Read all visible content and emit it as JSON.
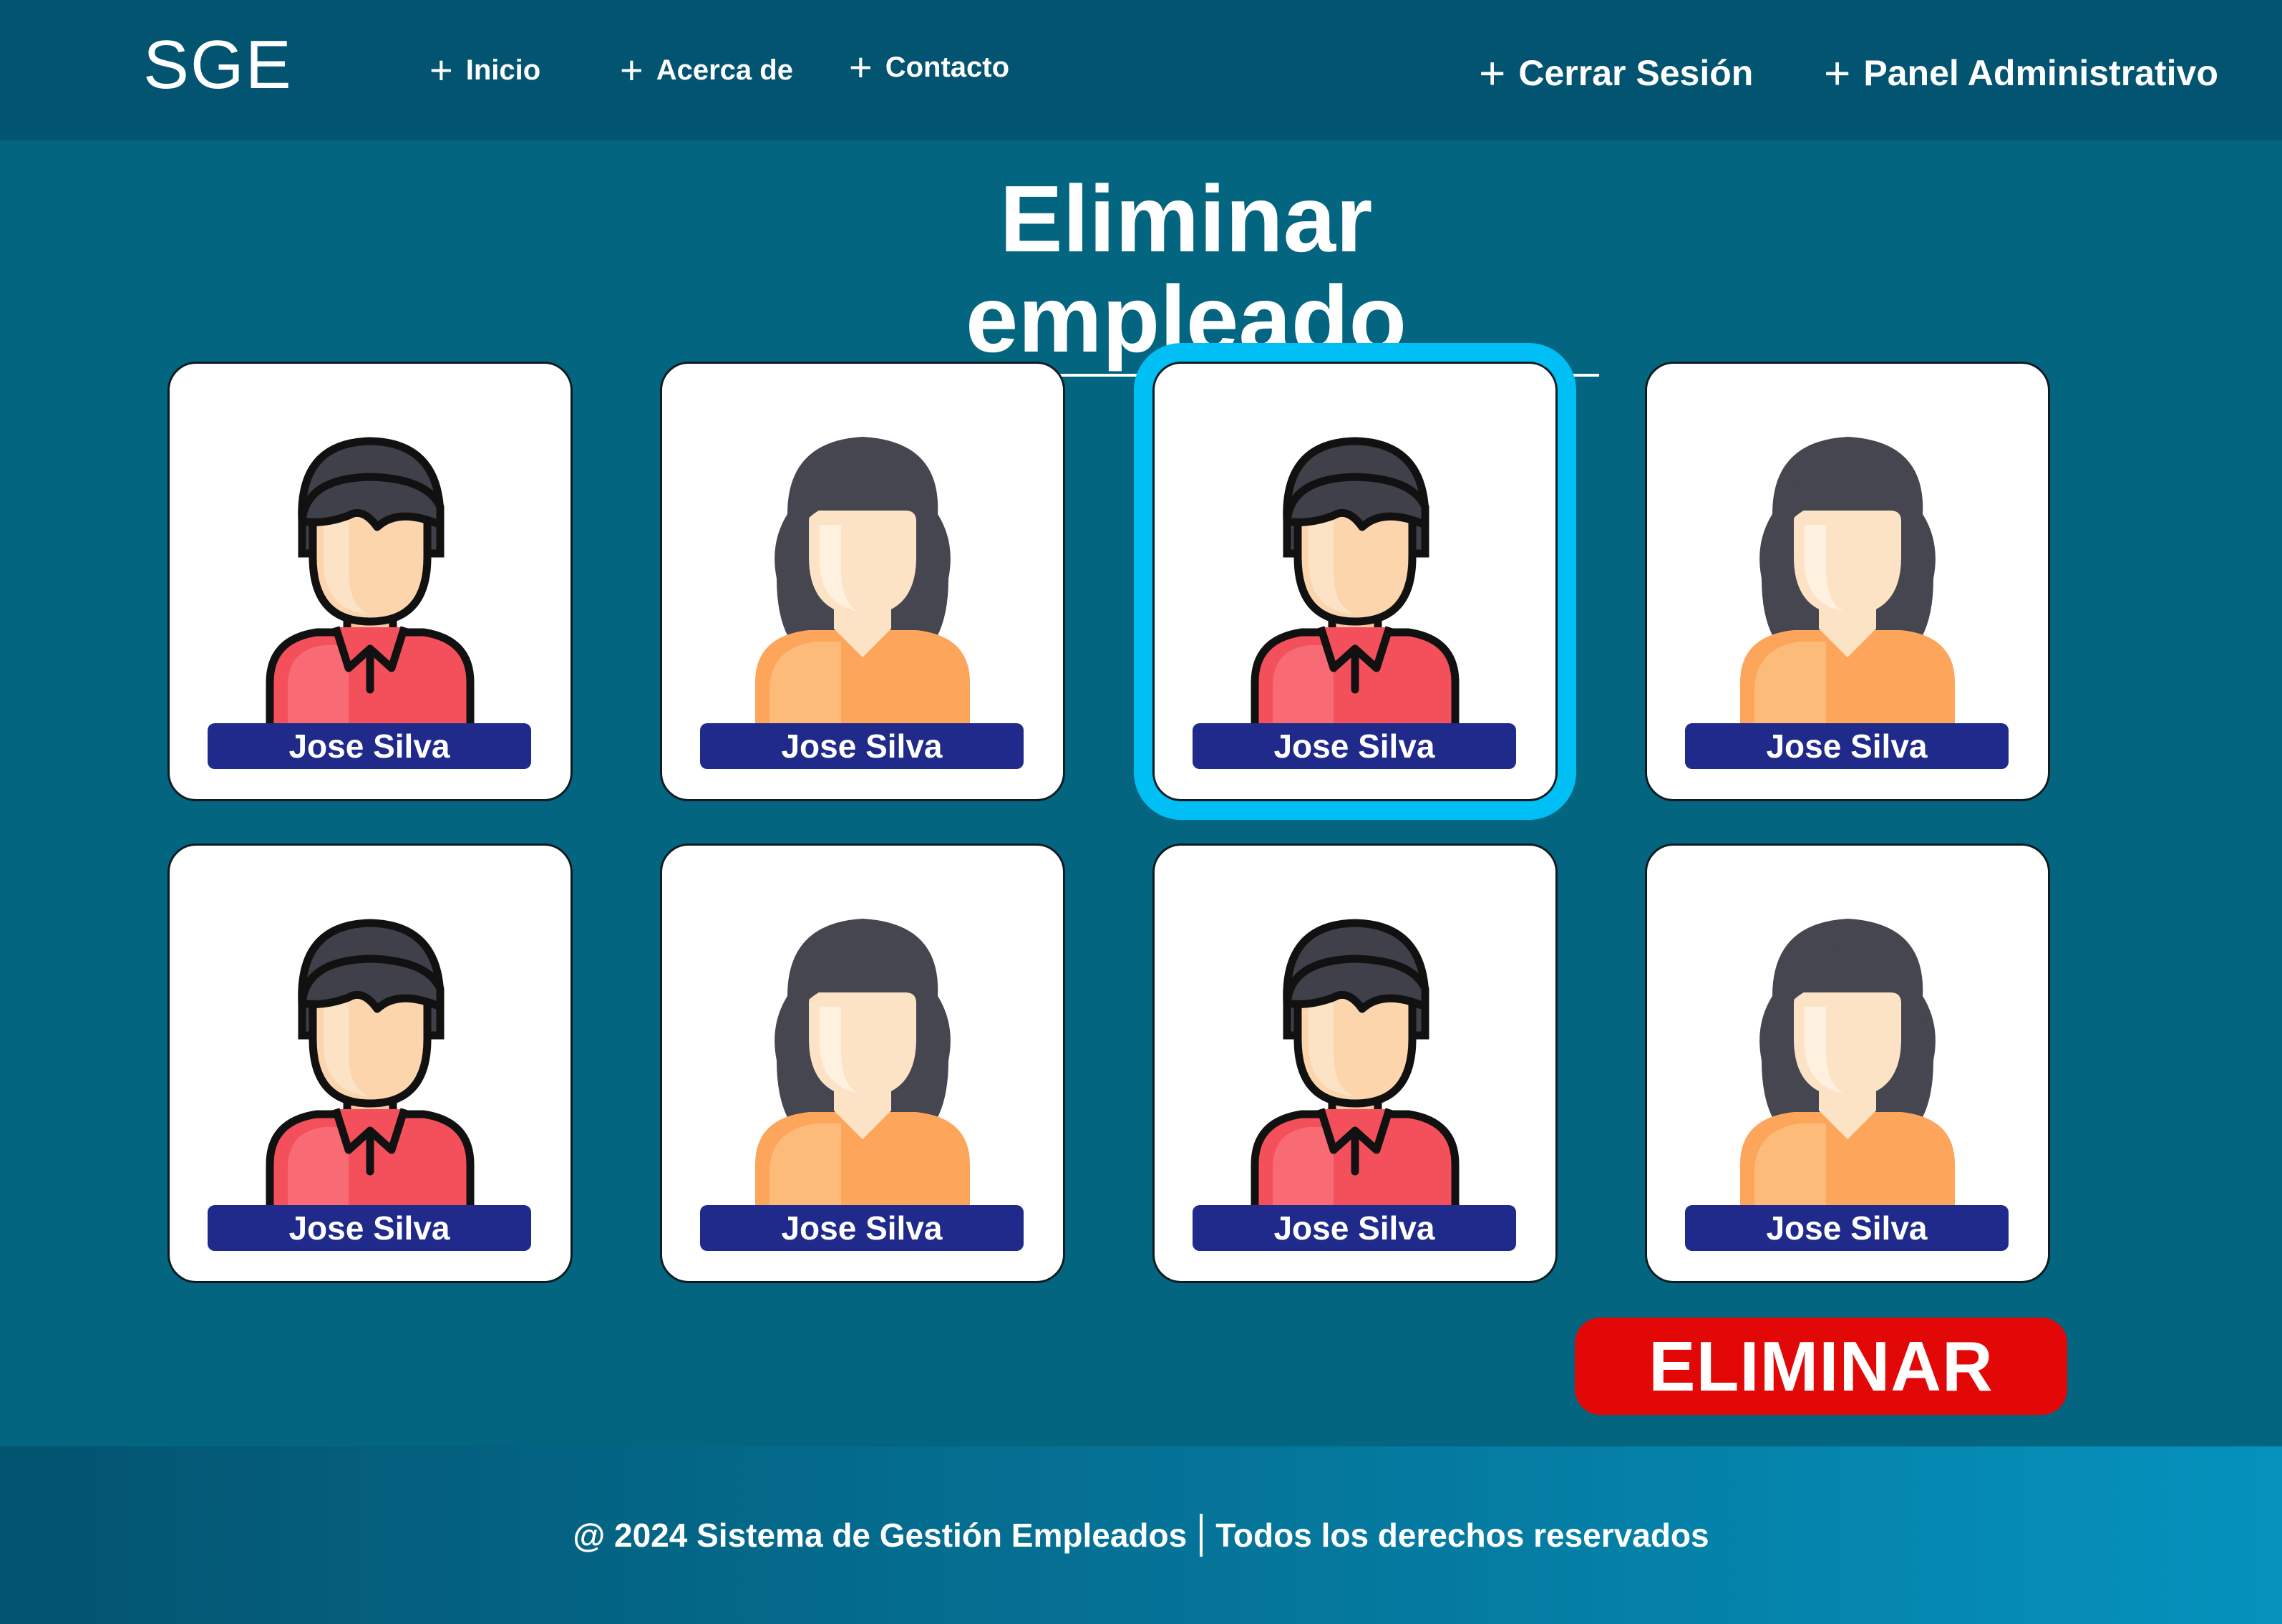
{
  "header": {
    "brand": "SGE",
    "nav": {
      "inicio": "Inicio",
      "acerca": "Acerca de",
      "contacto": "Contacto",
      "cerrar_sesion": "Cerrar Sesión",
      "panel": "Panel Administrativo"
    },
    "plus_icon": "+"
  },
  "main": {
    "title": "Eliminar empleado",
    "employees": [
      {
        "name": "Jose Silva",
        "avatar": "male-avatar-icon",
        "selected": false
      },
      {
        "name": "Jose Silva",
        "avatar": "female-avatar-icon",
        "selected": false
      },
      {
        "name": "Jose Silva",
        "avatar": "male-avatar-icon",
        "selected": true
      },
      {
        "name": "Jose Silva",
        "avatar": "female-avatar-icon",
        "selected": false
      },
      {
        "name": "Jose Silva",
        "avatar": "male-avatar-icon",
        "selected": false
      },
      {
        "name": "Jose Silva",
        "avatar": "female-avatar-icon",
        "selected": false
      },
      {
        "name": "Jose Silva",
        "avatar": "male-avatar-icon",
        "selected": false
      },
      {
        "name": "Jose Silva",
        "avatar": "female-avatar-icon",
        "selected": false
      }
    ],
    "delete_label": "ELIMINAR"
  },
  "footer": {
    "left": "@ 2024 Sistema de Gestión Empleados",
    "right": "Todos los derechos reservados"
  },
  "colors": {
    "header_bg": "#035470",
    "page_bg": "#03657f",
    "selection": "#00bff5",
    "name_tag": "#1f2a8a",
    "delete_button": "#e30808"
  }
}
